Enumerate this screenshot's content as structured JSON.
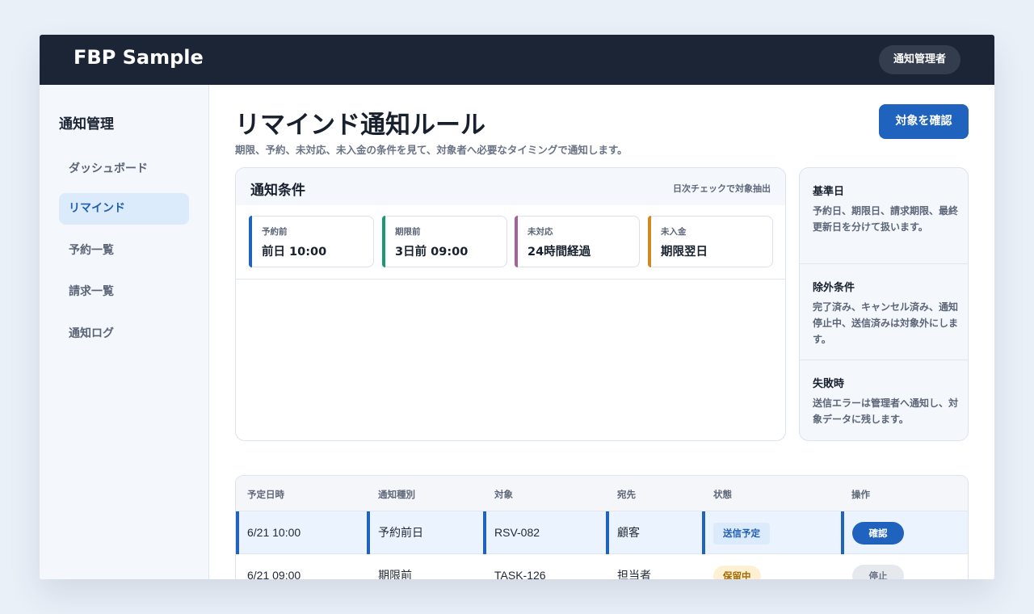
{
  "app": {
    "brand": "FBP Sample",
    "admin_label": "通知管理者"
  },
  "sidebar": {
    "title": "通知管理",
    "items": [
      {
        "label": "ダッシュボード",
        "active": false
      },
      {
        "label": "リマインド",
        "active": true
      },
      {
        "label": "予約一覧",
        "active": false
      },
      {
        "label": "請求一覧",
        "active": false
      },
      {
        "label": "通知ログ",
        "active": false
      }
    ]
  },
  "page": {
    "title": "リマインド通知ルール",
    "subtitle": "期限、予約、未対応、未入金の条件を見て、対象者へ必要なタイミングで通知します。",
    "confirm_label": "対象を確認"
  },
  "conditions": {
    "title": "通知条件",
    "note": "日次チェックで対象抽出",
    "cards": [
      {
        "label": "予約前",
        "value": "前日 10:00",
        "color": "#1f63bf"
      },
      {
        "label": "期限前",
        "value": "3日前 09:00",
        "color": "#1a9a72"
      },
      {
        "label": "未対応",
        "value": "24時間経過",
        "color": "#a7619a"
      },
      {
        "label": "未入金",
        "value": "期限翌日",
        "color": "#d18a1f"
      }
    ]
  },
  "rules": [
    {
      "title": "基準日",
      "desc": "予約日、期限日、請求期限、最終更新日を分けて扱います。"
    },
    {
      "title": "除外条件",
      "desc": "完了済み、キャンセル済み、通知停止中、送信済みは対象外にします。"
    },
    {
      "title": "失敗時",
      "desc": "送信エラーは管理者へ通知し、対象データに残します。"
    }
  ],
  "table": {
    "headers": [
      "予定日時",
      "通知種別",
      "対象",
      "宛先",
      "状態",
      "操作"
    ],
    "rows": [
      {
        "datetime": "6/21 10:00",
        "type": "予約前日",
        "target": "RSV-082",
        "to": "顧客",
        "status": "送信予定",
        "action": "確認"
      },
      {
        "datetime": "6/21 09:00",
        "type": "期限前",
        "target": "TASK-126",
        "to": "担当者",
        "status": "保留中",
        "action": "停止"
      }
    ]
  }
}
